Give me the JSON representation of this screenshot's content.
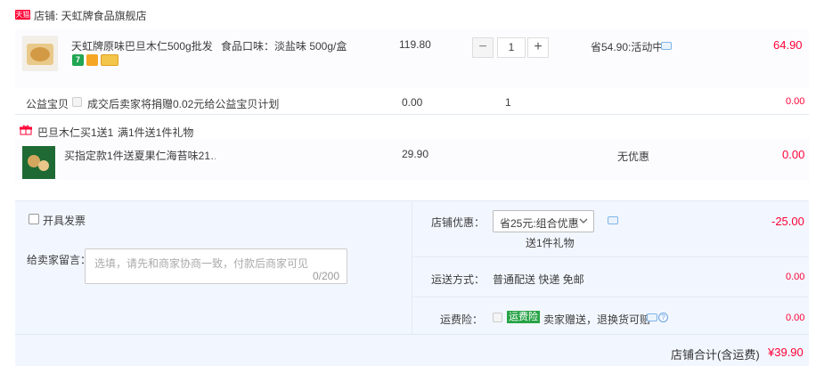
{
  "store": {
    "badge": "天猫",
    "label": "店铺: 天虹牌食品旗舰店"
  },
  "item": {
    "title": "天虹牌原味巴旦木仁500g批发…",
    "sku": "食品口味：淡盐味 500g/盒",
    "unit_price": "119.80",
    "quantity": "1",
    "minus": "−",
    "plus": "+",
    "promo": "省54.90:活动中",
    "subtotal": "64.90",
    "tag_icons": [
      "seven-day-return-icon",
      "quality-check-icon",
      "card-icon"
    ]
  },
  "charity": {
    "label": "公益宝贝",
    "text": "成交后卖家将捐赠0.02元给公益宝贝计划",
    "price": "0.00",
    "qty": "1",
    "subtotal": "0.00"
  },
  "gift_promo": {
    "label": "巴旦木仁买1送1",
    "desc": "满1件送1件礼物"
  },
  "gift_item": {
    "title": "买指定款1件送夏果仁海苔味21…",
    "price": "29.90",
    "discount": "无优惠",
    "subtotal": "0.00"
  },
  "invoice": {
    "label": "开具发票"
  },
  "message": {
    "label": "给卖家留言：",
    "placeholder": "选填，请先和商家协商一致，付款后商家可见",
    "counter": "0/200"
  },
  "shop_discount": {
    "label": "店铺优惠：",
    "selected": "省25元:组合优惠",
    "sub": "送1件礼物",
    "amount": "-25.00"
  },
  "shipping": {
    "label": "运送方式：",
    "value": "普通配送 快递 免邮",
    "amount": "0.00"
  },
  "insurance": {
    "label": "运费险：",
    "badge": "运费险",
    "text": "卖家赠送，退换货可赔",
    "amount": "0.00"
  },
  "total": {
    "label": "店铺合计(含运费)",
    "amount": "¥39.90"
  },
  "colors": {
    "accent": "#ff0036",
    "panel": "#f2f7ff",
    "badge_green": "#27a346"
  }
}
